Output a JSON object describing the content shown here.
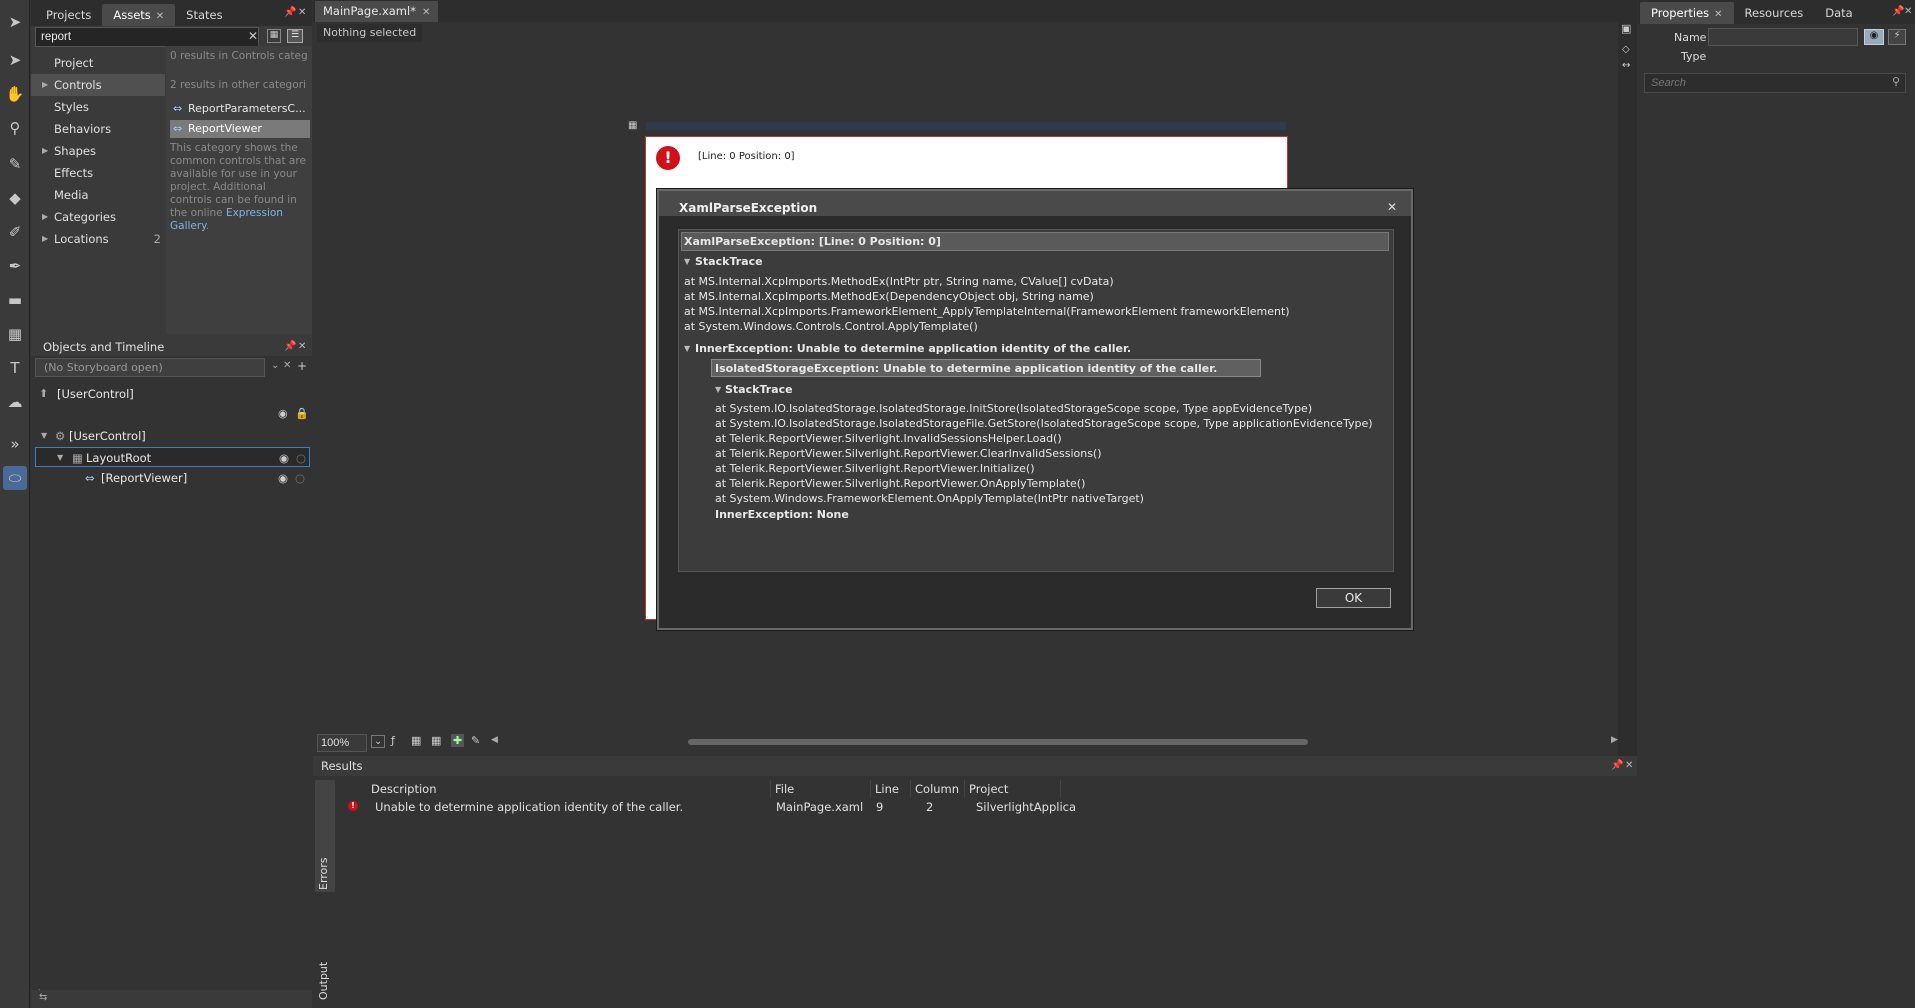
{
  "toolbox": {
    "icons": [
      "selection-icon",
      "direct-select-icon",
      "pan-icon",
      "zoom-icon",
      "eyedropper-icon",
      "paint-bucket-icon",
      "brush-icon",
      "pen-icon",
      "rectangle-icon",
      "grid-icon",
      "text-icon",
      "speech-icon",
      "chevron-right-icon",
      "assets-icon"
    ]
  },
  "assets_panel": {
    "tabs": [
      "Projects",
      "Assets",
      "States"
    ],
    "search_value": "report",
    "categories": [
      {
        "label": "Project",
        "has_children": false,
        "count": ""
      },
      {
        "label": "Controls",
        "has_children": true,
        "count": ""
      },
      {
        "label": "Styles",
        "has_children": false,
        "count": ""
      },
      {
        "label": "Behaviors",
        "has_children": false,
        "count": ""
      },
      {
        "label": "Shapes",
        "has_children": true,
        "count": ""
      },
      {
        "label": "Effects",
        "has_children": false,
        "count": ""
      },
      {
        "label": "Media",
        "has_children": false,
        "count": ""
      },
      {
        "label": "Categories",
        "has_children": true,
        "count": ""
      },
      {
        "label": "Locations",
        "has_children": true,
        "count": "2"
      }
    ],
    "result_text_1": "0 results in Controls categ",
    "result_text_2": "2 results in other categori",
    "items": [
      "ReportParametersC...",
      "ReportViewer"
    ],
    "description_text": "This category shows the common controls that are available for use in your project. Additional controls can be found in the online",
    "description_link": "Expression Gallery",
    "description_end": "."
  },
  "objects_panel": {
    "title": "Objects and Timeline",
    "storyboard": "(No Storyboard open)",
    "scope_label": "[UserControl]",
    "tree": [
      {
        "label": "[UserControl]",
        "level": 0
      },
      {
        "label": "LayoutRoot",
        "level": 1
      },
      {
        "label": "[ReportViewer]",
        "level": 2
      }
    ]
  },
  "document": {
    "tab_label": "MainPage.xaml*",
    "selection_status": "Nothing selected",
    "error_text": "[Line: 0 Position: 0]",
    "zoom": "100%"
  },
  "dialog": {
    "title": "XamlParseException",
    "header": "XamlParseException:  [Line: 0 Position: 0]",
    "stacktrace_label": "StackTrace",
    "stack1": [
      "at MS.Internal.XcpImports.MethodEx(IntPtr ptr, String name, CValue[] cvData)",
      "at MS.Internal.XcpImports.MethodEx(DependencyObject obj, String name)",
      "at MS.Internal.XcpImports.FrameworkElement_ApplyTemplateInternal(FrameworkElement frameworkElement)",
      "at System.Windows.Controls.Control.ApplyTemplate()"
    ],
    "inner_label": "InnerException: Unable to determine application identity of the caller.",
    "inner_header": "IsolatedStorageException: Unable to determine application identity of the caller.",
    "stack2": [
      "at System.IO.IsolatedStorage.IsolatedStorage.InitStore(IsolatedStorageScope scope, Type appEvidenceType)",
      "at System.IO.IsolatedStorage.IsolatedStorageFile.GetStore(IsolatedStorageScope scope, Type applicationEvidenceType)",
      "at Telerik.ReportViewer.Silverlight.InvalidSessionsHelper.Load()",
      "at Telerik.ReportViewer.Silverlight.ReportViewer.ClearInvalidSessions()",
      "at Telerik.ReportViewer.Silverlight.ReportViewer.Initialize()",
      "at Telerik.ReportViewer.Silverlight.ReportViewer.OnApplyTemplate()",
      "at System.Windows.FrameworkElement.OnApplyTemplate(IntPtr nativeTarget)"
    ],
    "inner_none": "InnerException: None",
    "ok_label": "OK"
  },
  "results_panel": {
    "title": "Results",
    "side_tabs": [
      "Errors",
      "Output"
    ],
    "columns": [
      "Description",
      "File",
      "Line",
      "Column",
      "Project"
    ],
    "rows": [
      {
        "description": "Unable to determine application identity of the caller.",
        "file": "MainPage.xaml",
        "line": "9",
        "column": "2",
        "project": "SilverlightApplica"
      }
    ]
  },
  "properties_panel": {
    "tabs": [
      "Properties",
      "Resources",
      "Data"
    ],
    "name_label": "Name",
    "type_label": "Type",
    "search_placeholder": "Search"
  }
}
